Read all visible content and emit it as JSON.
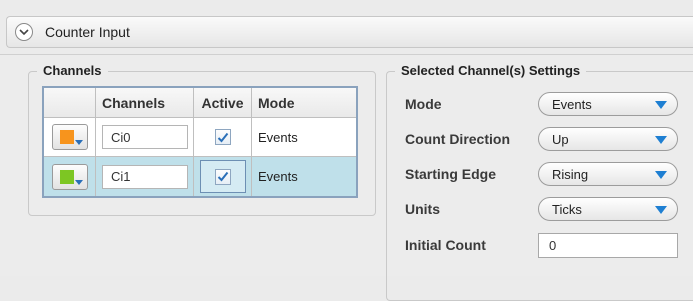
{
  "header": {
    "title": "Counter Input",
    "collapse_icon": "chevron-down-icon"
  },
  "channels": {
    "title": "Channels",
    "columns": [
      "",
      "Channels",
      "Active",
      "Mode"
    ],
    "rows": [
      {
        "color": "#f7941d",
        "name": "Ci0",
        "active": true,
        "mode": "Events",
        "selected": false
      },
      {
        "color": "#7dc623",
        "name": "Ci1",
        "active": true,
        "mode": "Events",
        "selected": true
      }
    ]
  },
  "settings": {
    "title": "Selected Channel(s) Settings",
    "mode": {
      "label": "Mode",
      "value": "Events"
    },
    "count_direction": {
      "label": "Count Direction",
      "value": "Up"
    },
    "starting_edge": {
      "label": "Starting Edge",
      "value": "Rising"
    },
    "units": {
      "label": "Units",
      "value": "Ticks"
    },
    "initial_count": {
      "label": "Initial Count",
      "value": "0"
    }
  }
}
